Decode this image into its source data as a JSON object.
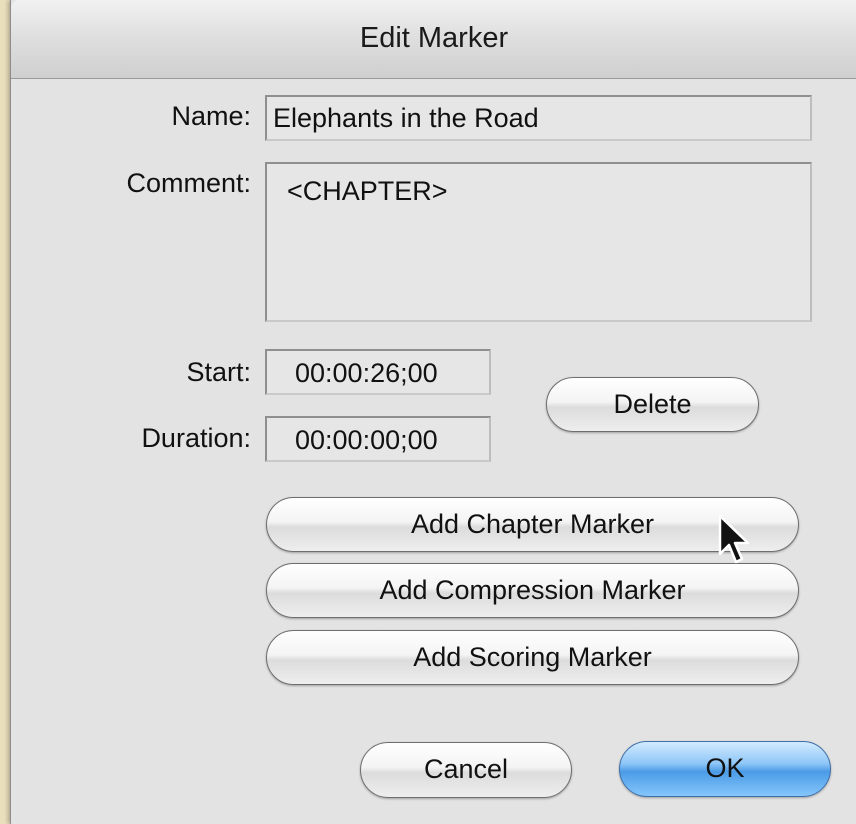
{
  "window": {
    "title": "Edit Marker"
  },
  "form": {
    "name_label": "Name:",
    "name_value": "Elephants in the Road",
    "comment_label": "Comment:",
    "comment_value": "<CHAPTER>",
    "start_label": "Start:",
    "start_value": "00:00:26;00",
    "duration_label": "Duration:",
    "duration_value": "00:00:00;00"
  },
  "buttons": {
    "delete": "Delete",
    "add_chapter": "Add Chapter Marker",
    "add_compression": "Add Compression Marker",
    "add_scoring": "Add Scoring Marker",
    "cancel": "Cancel",
    "ok": "OK"
  },
  "colors": {
    "desktop": "#eadfbd",
    "dialog": "#e3e3e3",
    "ok_accent": "#4b9be6"
  },
  "icons": {
    "pointer": "arrow-cursor-icon"
  }
}
